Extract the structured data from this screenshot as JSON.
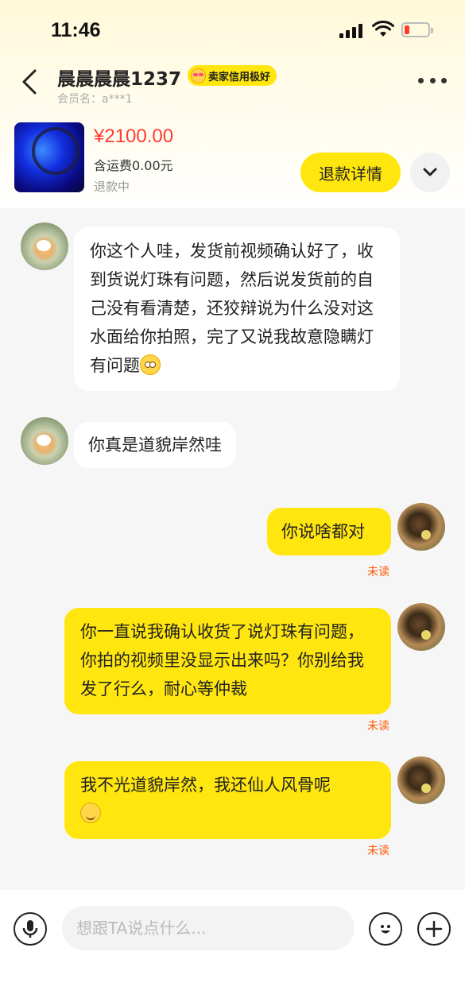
{
  "status_bar": {
    "time": "11:46"
  },
  "header": {
    "seller_name": "晨晨晨晨1237",
    "credit_badge": "卖家信用极好",
    "member_label": "会员名：a***1"
  },
  "product": {
    "price": "¥2100.00",
    "shipping": "含运费0.00元",
    "status": "退款中",
    "refund_button": "退款详情"
  },
  "messages": [
    {
      "side": "left",
      "text": "你这个人哇，发货前视频确认好了，收到货说灯珠有问题，然后说发货前的自己没有看清楚，还狡辩说为什么没对这水面给你拍照，完了又说我故意隐瞒灯有问题",
      "emoji": "flushed-face"
    },
    {
      "side": "left",
      "text": "你真是道貌岸然哇"
    },
    {
      "side": "right",
      "text": "你说啥都对",
      "read_status": "未读"
    },
    {
      "side": "right",
      "text": "你一直说我确认收货了说灯珠有问题，你拍的视频里没显示出来吗？你别给我发了行么，耐心等仲裁",
      "read_status": "未读"
    },
    {
      "side": "right",
      "text": "我不光道貌岸然，我还仙人风骨呢",
      "emoji": "smiling-face",
      "read_status": "未读"
    }
  ],
  "input_bar": {
    "placeholder": "想跟TA说点什么..."
  },
  "colors": {
    "accent": "#ffe60f",
    "price": "#ff3b30",
    "unread": "#ff5500"
  }
}
